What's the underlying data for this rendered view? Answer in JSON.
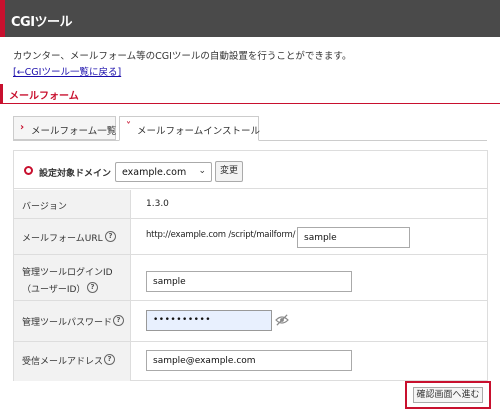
{
  "header": {
    "title": "CGIツール"
  },
  "description": "カウンター、メールフォーム等のCGIツールの自動設置を行うことができます。",
  "back_link": "[←CGIツール一覧に戻る]",
  "section": {
    "title": "メールフォーム"
  },
  "tabs": [
    {
      "label": "メールフォーム一覧",
      "active": false
    },
    {
      "label": "メールフォームインストール",
      "active": true
    }
  ],
  "form": {
    "domain": {
      "label": "設定対象ドメイン",
      "selected": "example.com",
      "change_label": "変更"
    },
    "version": {
      "label": "バージョン",
      "value": "1.3.0"
    },
    "url": {
      "label": "メールフォームURL",
      "prefix": "http://example.com /script/mailform/",
      "value": "sample"
    },
    "admin_id": {
      "label_line1": "管理ツールログインID",
      "label_line2": "（ユーザーID）",
      "value": "sample"
    },
    "admin_pw": {
      "label": "管理ツールパスワード",
      "value": "••••••••••"
    },
    "receive_mail": {
      "label": "受信メールアドレス",
      "value": "sample@example.com"
    }
  },
  "confirm_button": {
    "label": "確認画面へ進む"
  },
  "colors": {
    "accent": "#c8102e",
    "header_bg": "#4a4a4a"
  }
}
